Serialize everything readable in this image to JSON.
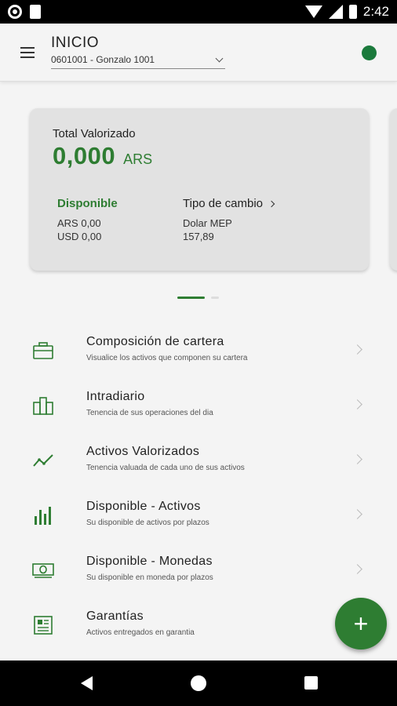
{
  "status_bar": {
    "time": "2:42"
  },
  "app_bar": {
    "title": "INICIO",
    "account": "0601001 - Gonzalo 1001"
  },
  "summary_card": {
    "total_label": "Total Valorizado",
    "total_value": "0,000",
    "total_currency": "ARS",
    "disponible": {
      "label": "Disponible",
      "lines": [
        "ARS 0,00",
        "USD 0,00"
      ]
    },
    "tipo_cambio": {
      "label": "Tipo de cambio",
      "name": "Dolar MEP",
      "value": "157,89"
    }
  },
  "pager": {
    "pages": 2,
    "active": 0
  },
  "menu": {
    "items": [
      {
        "title": "Composición de cartera",
        "subtitle": "Visualice los activos que componen su cartera",
        "icon": "briefcase-icon"
      },
      {
        "title": "Intradiario",
        "subtitle": "Tenencia de sus operaciones del dia",
        "icon": "buildings-icon"
      },
      {
        "title": "Activos Valorizados",
        "subtitle": "Tenencia valuada de cada uno de sus activos",
        "icon": "trend-line-icon"
      },
      {
        "title": "Disponible - Activos",
        "subtitle": "Su disponible de activos por plazos",
        "icon": "bar-chart-icon"
      },
      {
        "title": "Disponible - Monedas",
        "subtitle": "Su disponible en moneda por plazos",
        "icon": "banknote-icon"
      },
      {
        "title": "Garantías",
        "subtitle": "Activos entregados en garantia",
        "icon": "document-icon"
      }
    ]
  },
  "fab": {
    "label": "+"
  },
  "colors": {
    "accent": "#2e7d32",
    "card_bg": "#e2e2e2",
    "page_bg": "#f4f4f4"
  }
}
